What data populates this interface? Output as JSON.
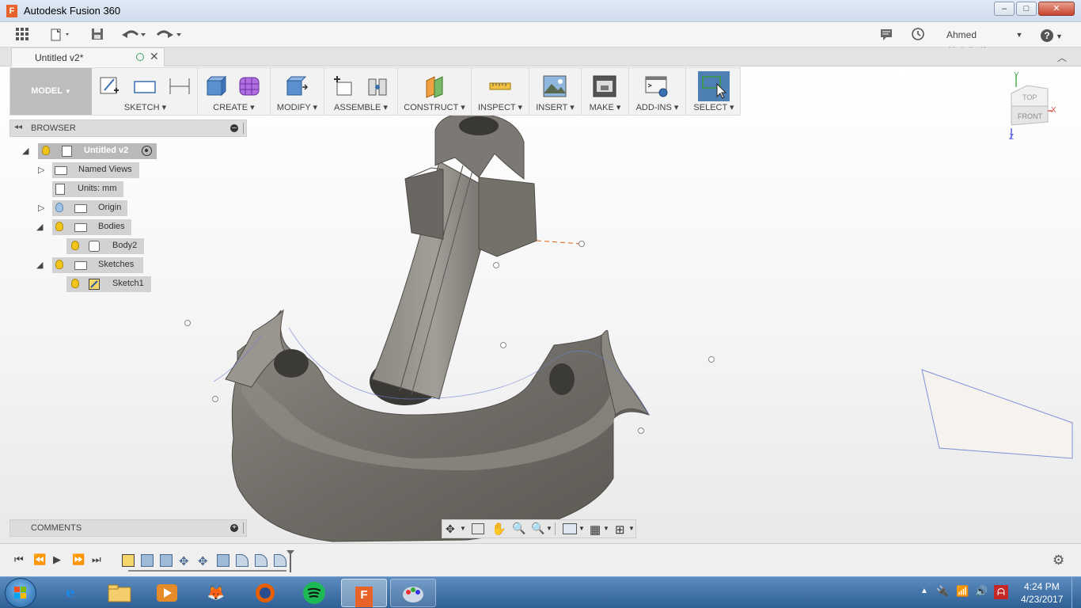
{
  "window": {
    "title": "Autodesk Fusion 360",
    "app_icon_letter": "F",
    "minimize": "–",
    "maximize": "□",
    "close": "✕"
  },
  "quick_access": {
    "user_name": "Ahmed Abdellatif",
    "help": "?"
  },
  "document_tab": {
    "title": "Untitled v2*"
  },
  "toolbar": {
    "workspace": "MODEL",
    "groups": [
      {
        "label": "SKETCH"
      },
      {
        "label": "CREATE"
      },
      {
        "label": "MODIFY"
      },
      {
        "label": "ASSEMBLE"
      },
      {
        "label": "CONSTRUCT"
      },
      {
        "label": "INSPECT"
      },
      {
        "label": "INSERT"
      },
      {
        "label": "MAKE"
      },
      {
        "label": "ADD-INS"
      },
      {
        "label": "SELECT"
      }
    ]
  },
  "browser": {
    "title": "BROWSER",
    "root": "Untitled v2",
    "named_views": "Named Views",
    "units": "Units: mm",
    "origin": "Origin",
    "bodies": "Bodies",
    "body2": "Body2",
    "sketches": "Sketches",
    "sketch1": "Sketch1"
  },
  "comments": {
    "title": "COMMENTS"
  },
  "viewcube": {
    "top": "TOP",
    "front": "FRONT",
    "axis_y": "Y",
    "axis_x": "X",
    "axis_z": "Z"
  },
  "taskbar": {
    "time": "4:24 PM",
    "date": "4/23/2017"
  },
  "colors": {
    "accent": "#e8632a",
    "select_active": "#4d7fb5",
    "body_gray": "#7a7670"
  }
}
